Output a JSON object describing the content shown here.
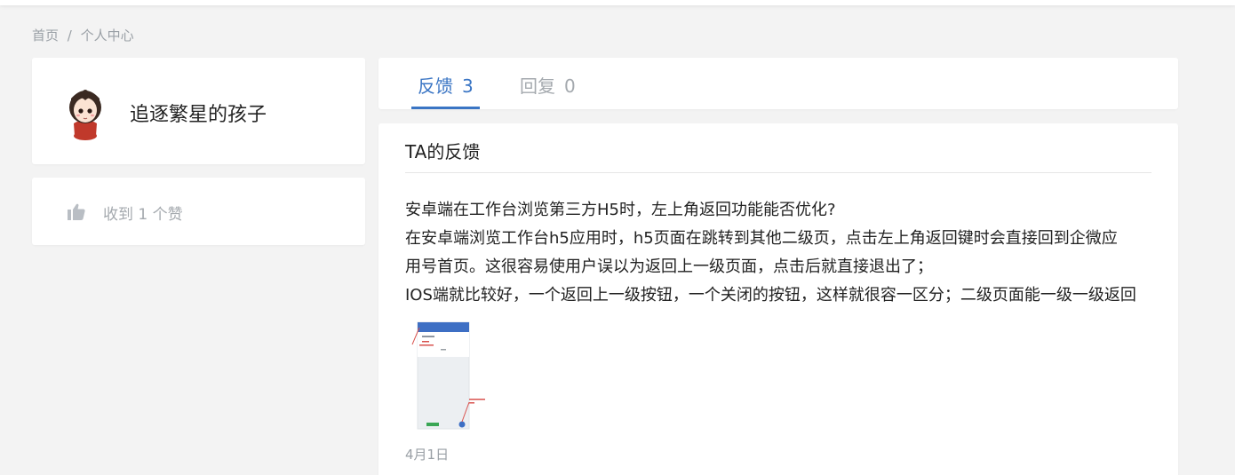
{
  "breadcrumb": {
    "home": "首页",
    "separator": "/",
    "current": "个人中心"
  },
  "profile": {
    "username": "追逐繁星的孩子",
    "avatar_icon": "avatar-girl"
  },
  "likes": {
    "icon": "thumbs-up-icon",
    "text": "收到 1 个赞"
  },
  "tabs": [
    {
      "label": "反馈",
      "count": "3",
      "active": true
    },
    {
      "label": "回复",
      "count": "0",
      "active": false
    }
  ],
  "section": {
    "title": "TA的反馈"
  },
  "post": {
    "title": "安卓端在工作台浏览第三方H5时，左上角返回功能能否优化?",
    "lines": [
      "在安卓端浏览工作台h5应用时，h5页面在跳转到其他二级页，点击左上角返回键时会直接回到企微应",
      "用号首页。这很容易使用户误以为返回上一级页面，点击后就直接退出了；",
      "IOS端就比较好，一个返回上一级按钮，一个关闭的按钮，这样就很容一区分；二级页面能一级一级返回"
    ],
    "date": "4月1日"
  },
  "colors": {
    "accent": "#3a75c4",
    "muted": "#a4a9ae",
    "background": "#f3f3f3"
  }
}
